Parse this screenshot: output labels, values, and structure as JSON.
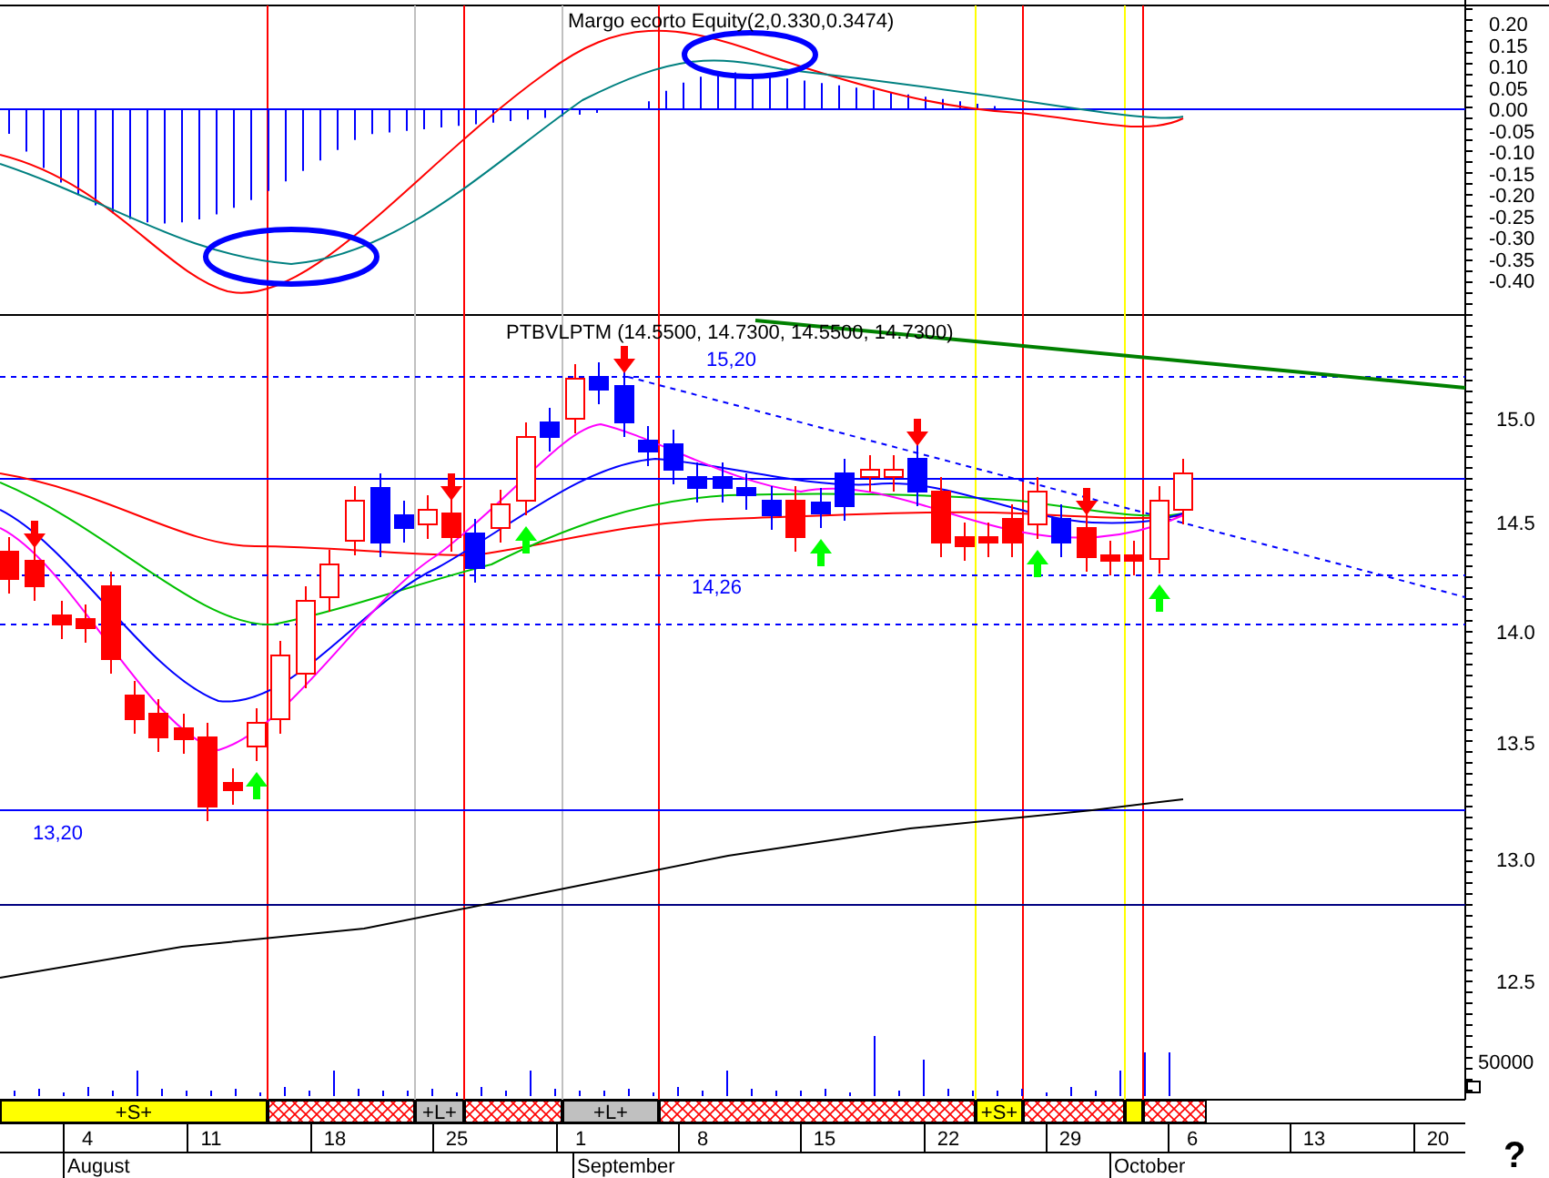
{
  "macd_panel": {
    "title": "Margo ecorto Equity(2,0.330,0.3474)",
    "yticks": [
      "0.20",
      "0.15",
      "0.10",
      "0.05",
      "0.00",
      "-0.05",
      "-0.10",
      "-0.15",
      "-0.20",
      "-0.25",
      "-0.30",
      "-0.35",
      "-0.40"
    ]
  },
  "price_panel": {
    "title": "PTBVLPTM (14.5500, 14.7300, 14.5500, 14.7300)",
    "yticks": [
      "15.0",
      "14.5",
      "14.0",
      "13.5",
      "13.0",
      "12.5"
    ],
    "level_labels": [
      "15,20",
      "14,26",
      "13,20"
    ]
  },
  "volume_panel": {
    "ytick": "50000"
  },
  "signal_bar": [
    {
      "kind": "short",
      "label": "+S+"
    },
    {
      "kind": "none"
    },
    {
      "kind": "long",
      "label": "+L+"
    },
    {
      "kind": "none"
    },
    {
      "kind": "long",
      "label": "+L+"
    },
    {
      "kind": "none"
    },
    {
      "kind": "short",
      "label": "+S+"
    },
    {
      "kind": "none"
    },
    {
      "kind": "short"
    },
    {
      "kind": "none"
    }
  ],
  "date_axis": {
    "days": [
      "4",
      "11",
      "18",
      "25",
      "1",
      "8",
      "15",
      "22",
      "29",
      "6",
      "13",
      "20"
    ],
    "months": [
      "August",
      "September",
      "October"
    ]
  },
  "help_mark": "?"
}
